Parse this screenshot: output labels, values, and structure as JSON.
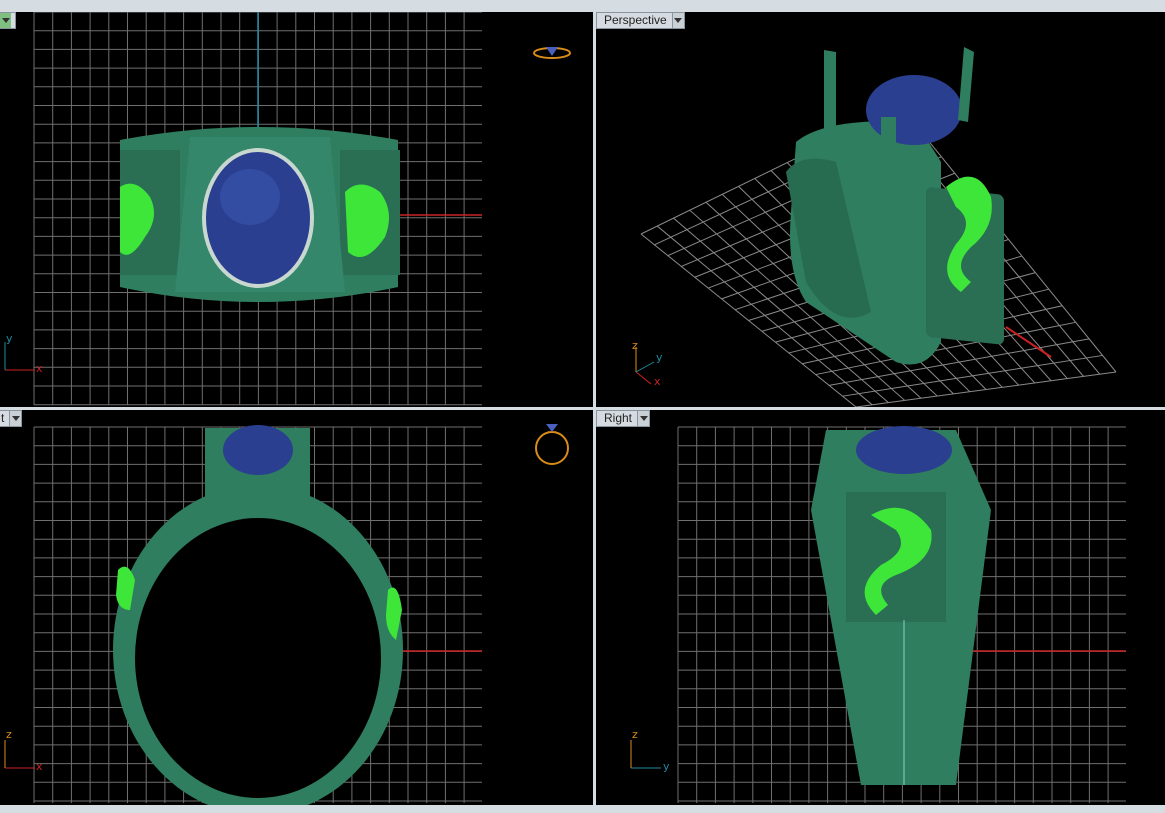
{
  "app": {
    "accent_green": "#2f7e5f",
    "gem_blue": "#2a3f8f",
    "relief_green": "#3ee63a",
    "grid_color": "#6f6f6f",
    "axis_red": "#cc2222",
    "axis_cyan": "#1f8aa0"
  },
  "viewports": {
    "top": {
      "tab_label": "",
      "icon": "ring-top-widget-icon",
      "axes": [
        "y",
        "x"
      ]
    },
    "perspective": {
      "tab_label": "Perspective",
      "axes": [
        "z",
        "y",
        "x"
      ]
    },
    "front": {
      "tab_label": "t",
      "icon": "ring-front-widget-icon",
      "axes": [
        "z",
        "x"
      ]
    },
    "right": {
      "tab_label": "Right",
      "axes": [
        "z",
        "y"
      ]
    }
  }
}
